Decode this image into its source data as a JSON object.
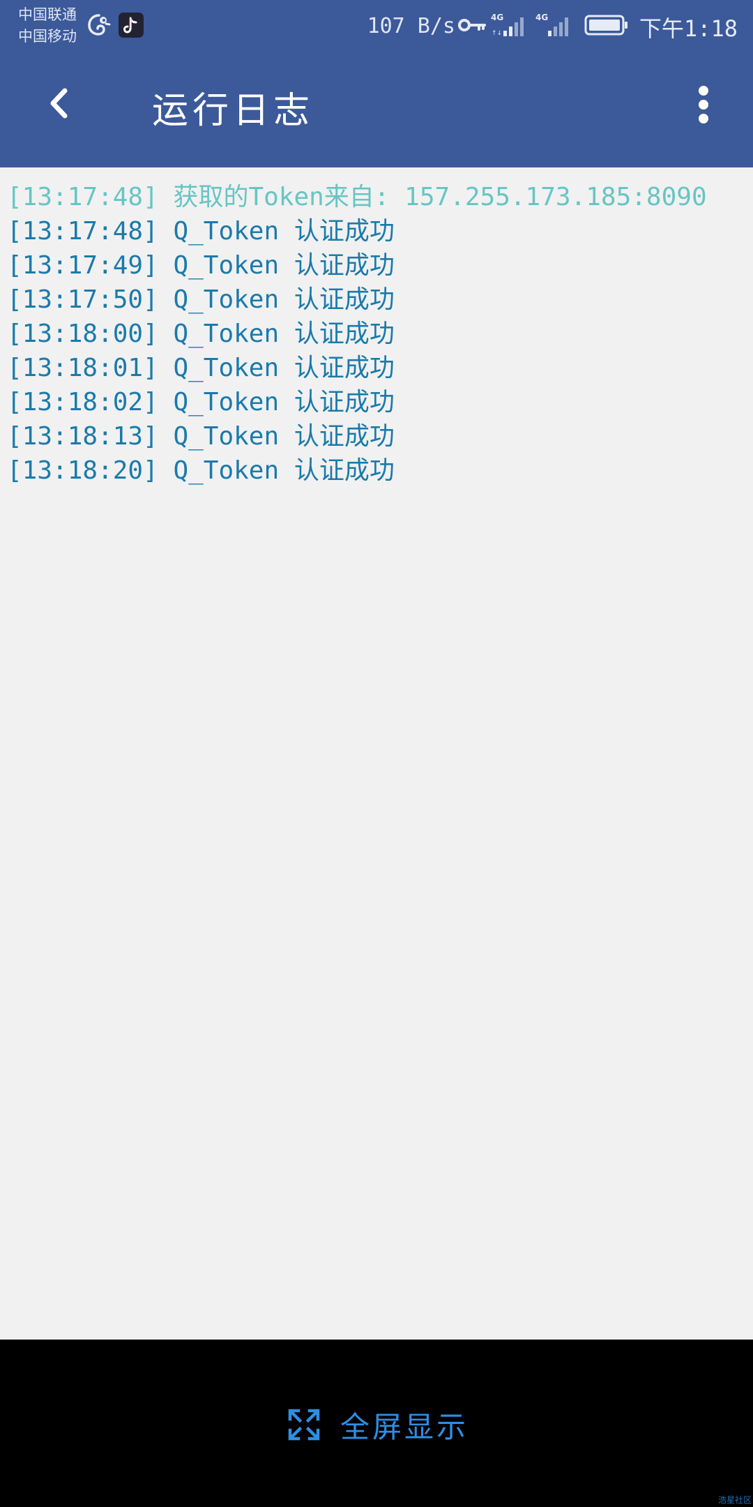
{
  "status_bar": {
    "carrier_1": "中国联通",
    "carrier_2": "中国移动",
    "net_speed": "107 B/s",
    "signal_1_label": "4G",
    "signal_2_label": "4G",
    "time": "下午1:18",
    "icons": [
      "chameleon-app-icon",
      "tiktok-icon",
      "key-icon",
      "signal-icon",
      "battery-icon"
    ]
  },
  "app_bar": {
    "title": "运行日志",
    "back_icon": "chevron-left-icon",
    "more_icon": "more-vert-icon"
  },
  "log": {
    "entries": [
      {
        "time": "[13:17:48]",
        "message": "获取的Token来自:  157.255.173.185:8090",
        "level": "info"
      },
      {
        "time": "[13:17:48]",
        "message": "Q_Token 认证成功",
        "level": "success"
      },
      {
        "time": "[13:17:49]",
        "message": "Q_Token 认证成功",
        "level": "success"
      },
      {
        "time": "[13:17:50]",
        "message": "Q_Token 认证成功",
        "level": "success"
      },
      {
        "time": "[13:18:00]",
        "message": "Q_Token 认证成功",
        "level": "success"
      },
      {
        "time": "[13:18:01]",
        "message": "Q_Token 认证成功",
        "level": "success"
      },
      {
        "time": "[13:18:02]",
        "message": "Q_Token 认证成功",
        "level": "success"
      },
      {
        "time": "[13:18:13]",
        "message": "Q_Token 认证成功",
        "level": "success"
      },
      {
        "time": "[13:18:20]",
        "message": "Q_Token 认证成功",
        "level": "success"
      }
    ]
  },
  "bottom_bar": {
    "fullscreen_label": "全屏显示",
    "fullscreen_icon": "expand-icon",
    "watermark": "浩星社区"
  },
  "colors": {
    "header_bg": "#3c5999",
    "log_bg": "#f1f1f1",
    "log_success": "#1b7aab",
    "log_info": "#67c5c4",
    "bottom_bg": "#000000",
    "accent": "#2f8ee3"
  }
}
